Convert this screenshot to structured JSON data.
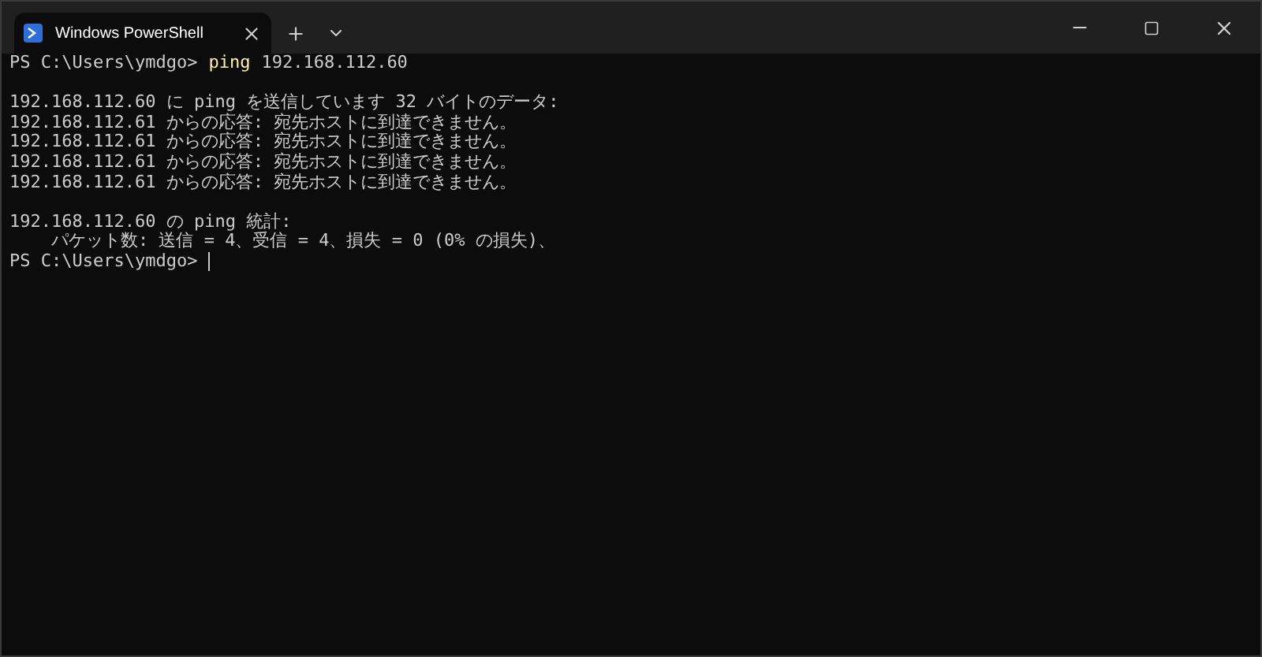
{
  "tabs": [
    {
      "title": "Windows PowerShell",
      "selected": true
    }
  ],
  "terminal": {
    "lines": [
      {
        "kind": "prompt",
        "prompt": "PS C:\\Users\\ymdgo>",
        "command": "ping",
        "args": "192.168.112.60"
      },
      {
        "kind": "blank"
      },
      {
        "kind": "output",
        "text": "192.168.112.60 に ping を送信しています 32 バイトのデータ:"
      },
      {
        "kind": "output",
        "text": "192.168.112.61 からの応答: 宛先ホストに到達できません。"
      },
      {
        "kind": "output",
        "text": "192.168.112.61 からの応答: 宛先ホストに到達できません。"
      },
      {
        "kind": "output",
        "text": "192.168.112.61 からの応答: 宛先ホストに到達できません。"
      },
      {
        "kind": "output",
        "text": "192.168.112.61 からの応答: 宛先ホストに到達できません。"
      },
      {
        "kind": "blank"
      },
      {
        "kind": "output",
        "text": "192.168.112.60 の ping 統計:"
      },
      {
        "kind": "output",
        "text": "    パケット数: 送信 = 4、受信 = 4、損失 = 0 (0% の損失)、"
      },
      {
        "kind": "prompt",
        "prompt": "PS C:\\Users\\ymdgo>",
        "cursor": true
      }
    ]
  }
}
